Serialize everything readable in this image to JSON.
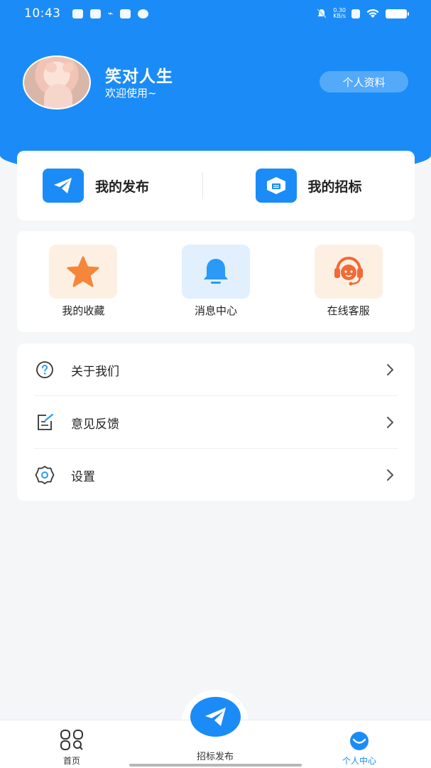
{
  "status_bar": {
    "time": "10:43",
    "net_speed_value": "0.30",
    "net_speed_unit": "KB/s"
  },
  "profile": {
    "username": "笑对人生",
    "welcome": "欢迎使用~",
    "profile_button": "个人资料"
  },
  "top_actions": [
    {
      "label": "我的发布",
      "icon": "paper-plane-icon"
    },
    {
      "label": "我的招标",
      "icon": "tender-box-icon"
    }
  ],
  "grid_actions": [
    {
      "label": "我的收藏",
      "icon": "star-icon",
      "color": "#f5863a"
    },
    {
      "label": "消息中心",
      "icon": "bell-icon",
      "color": "#2b9af6"
    },
    {
      "label": "在线客服",
      "icon": "customer-service-icon",
      "color": "#f26a35"
    }
  ],
  "menu": [
    {
      "label": "关于我们",
      "icon": "question-circle-icon"
    },
    {
      "label": "意见反馈",
      "icon": "feedback-edit-icon"
    },
    {
      "label": "设置",
      "icon": "gear-icon"
    }
  ],
  "bottom_nav": [
    {
      "label": "首页",
      "icon": "home-grid-icon",
      "active": false
    },
    {
      "label": "招标发布",
      "icon": "paper-plane-icon",
      "active": false
    },
    {
      "label": "个人中心",
      "icon": "smile-face-icon",
      "active": true
    }
  ],
  "colors": {
    "primary": "#1b8cf7",
    "background": "#f5f6f8",
    "text": "#222222"
  }
}
